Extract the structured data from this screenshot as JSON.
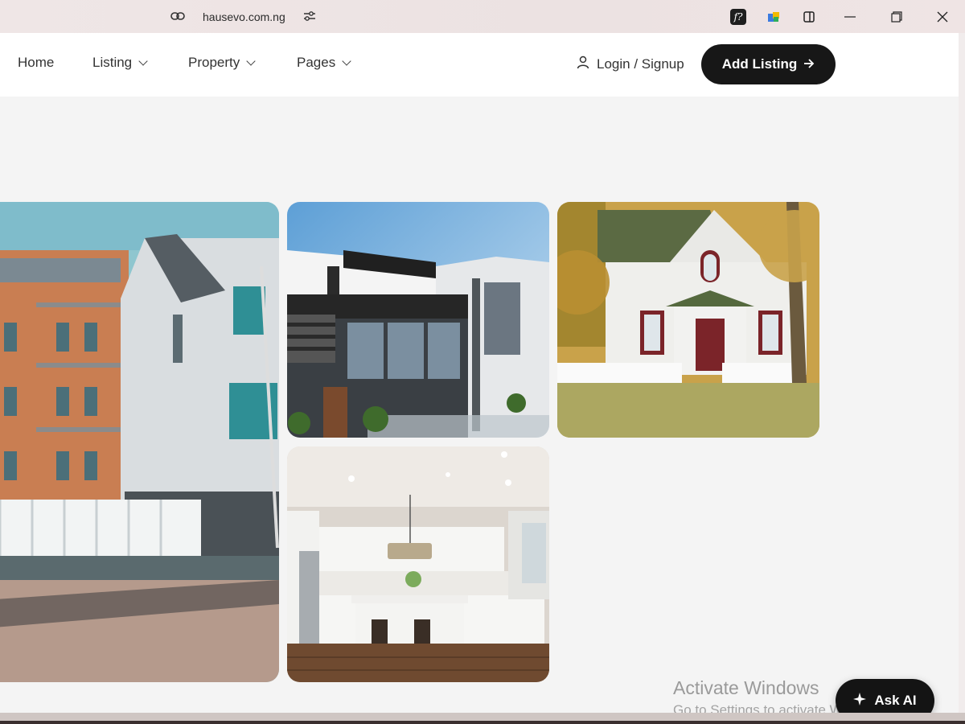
{
  "browser": {
    "url": "hausevo.com.ng",
    "icons": [
      "link-icon",
      "site-settings-icon",
      "extension-f-icon",
      "extension-puzzle-icon",
      "split-view-icon",
      "minimize-icon",
      "restore-icon",
      "close-icon"
    ]
  },
  "nav": {
    "items": [
      {
        "label": "Home",
        "has_dropdown": false
      },
      {
        "label": "Listing",
        "has_dropdown": true
      },
      {
        "label": "Property",
        "has_dropdown": true
      },
      {
        "label": "Pages",
        "has_dropdown": true
      }
    ],
    "login_label": "Login / Signup",
    "add_listing_label": "Add Listing"
  },
  "gallery": {
    "images": [
      "apartment-block-street",
      "modern-glass-villa",
      "white-cottage-autumn",
      "modern-kitchen-island"
    ]
  },
  "watermark": {
    "title": "Activate Windows",
    "subtitle": "Go to Settings to activate Windows."
  },
  "ask_ai": {
    "label": "Ask AI"
  },
  "colors": {
    "accent": "#171717",
    "page_bg": "#f4f4f4"
  }
}
